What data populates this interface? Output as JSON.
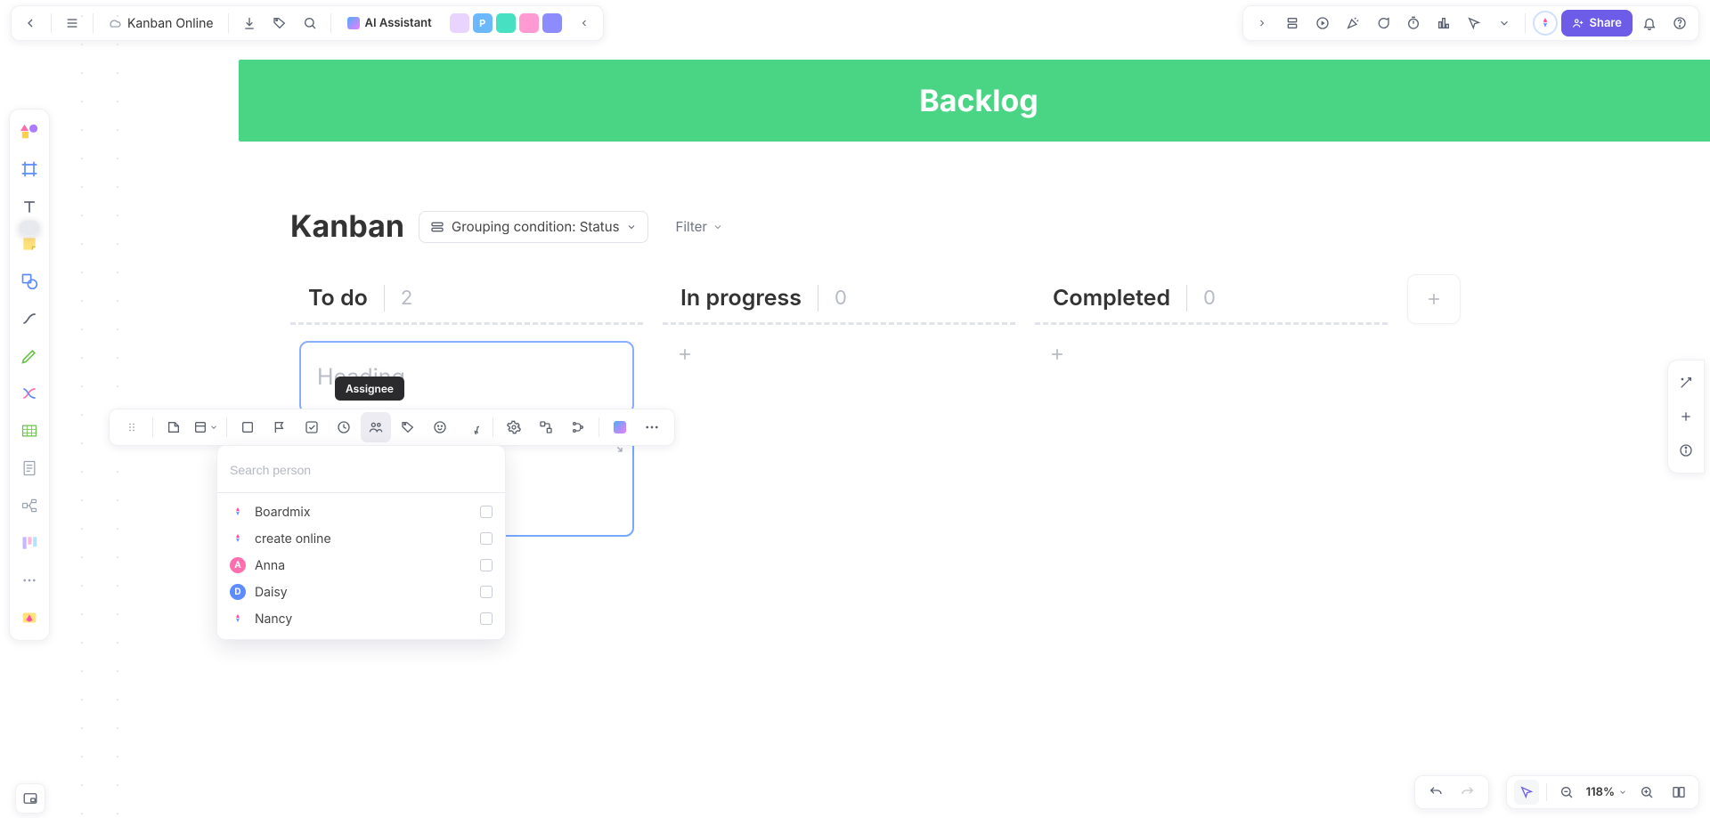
{
  "header": {
    "doc_title": "Kanban Online",
    "ai_label": "AI Assistant",
    "share_label": "Share",
    "collab_avatars": [
      {
        "label": "",
        "bg": "#e8d4ff"
      },
      {
        "label": "P",
        "bg": "#6bb8ff"
      },
      {
        "label": "",
        "bg": "#48e0c2"
      },
      {
        "label": "",
        "bg": "#ff9bd2"
      },
      {
        "label": "",
        "bg": "#8c8cff"
      }
    ]
  },
  "banner": {
    "title": "Backlog",
    "bg": "#4ad585"
  },
  "kanban": {
    "title": "Kanban",
    "grouping_label": "Grouping condition: Status",
    "filter_label": "Filter",
    "columns": [
      {
        "name": "To do",
        "count": "2"
      },
      {
        "name": "In progress",
        "count": "0"
      },
      {
        "name": "Completed",
        "count": "0"
      }
    ],
    "card_placeholder": "Heading"
  },
  "toolbar_tooltip": "Assignee",
  "assignee_popup": {
    "placeholder": "Search person",
    "people": [
      {
        "name": "Boardmix",
        "type": "logo",
        "bg": "#ffffff"
      },
      {
        "name": "create online",
        "type": "logo",
        "bg": "#ffffff"
      },
      {
        "name": "Anna",
        "type": "letter",
        "letter": "A",
        "bg": "#ff6fb0"
      },
      {
        "name": "Daisy",
        "type": "letter",
        "letter": "D",
        "bg": "#5c8cff"
      },
      {
        "name": "Nancy",
        "type": "logo",
        "bg": "#ffffff"
      }
    ]
  },
  "zoom": {
    "level": "118%"
  }
}
